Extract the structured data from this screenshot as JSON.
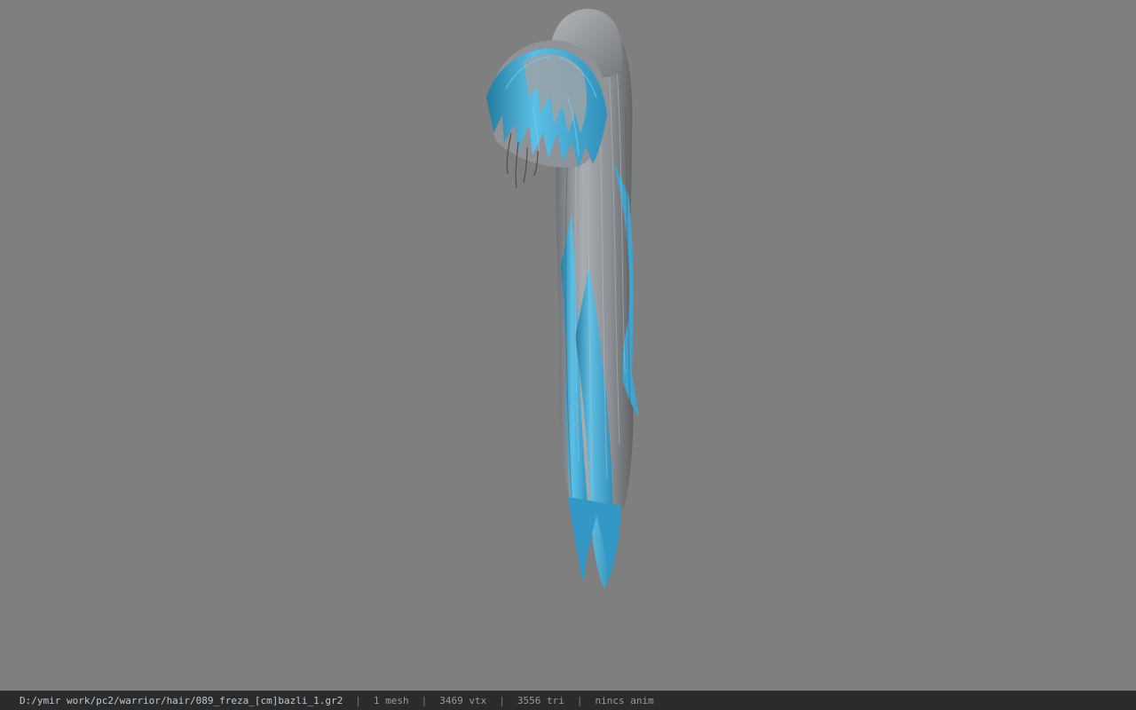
{
  "viewport": {
    "background_color": "#7f7f7f",
    "model": "hair-mesh",
    "hair_colors": {
      "gray": "#9c9fa3",
      "gray_dark": "#6e7175",
      "blue": "#3ea3cf",
      "blue_light": "#5cc0e6",
      "blue_dark": "#247aa0"
    }
  },
  "status": {
    "path": "D:/ymir work/pc2/warrior/hair/089_freza_[cm]bazli_1.gr2",
    "separator": "|",
    "mesh_count": "1 mesh",
    "vertex_count": "3469 vtx",
    "triangle_count": "3556 tri",
    "anim_status": "nincs anim"
  }
}
